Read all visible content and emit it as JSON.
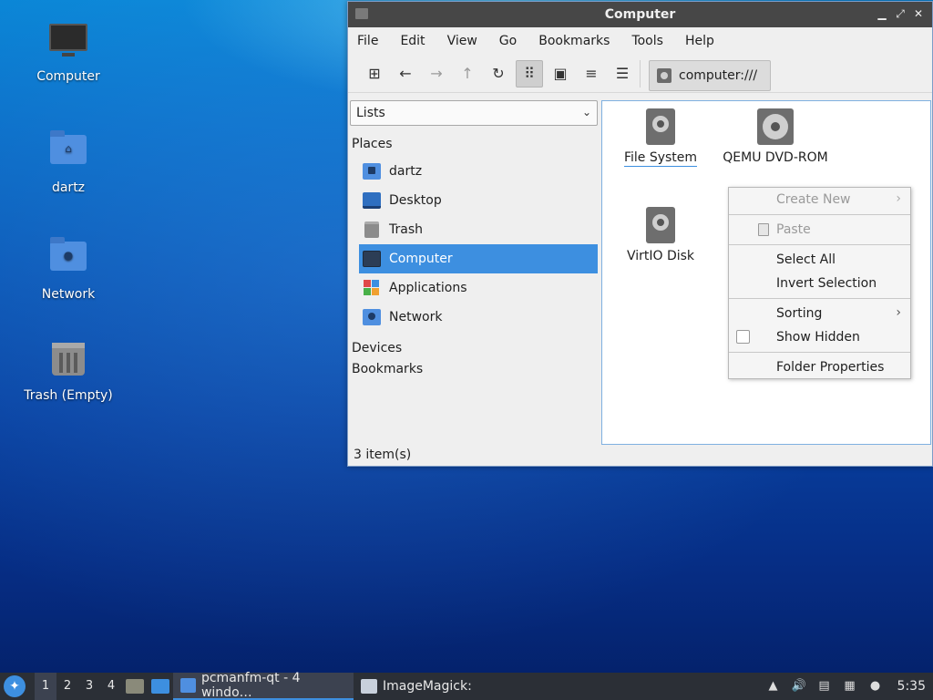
{
  "desktop": {
    "icons": [
      {
        "label": "Computer"
      },
      {
        "label": "dartz"
      },
      {
        "label": "Network"
      },
      {
        "label": "Trash (Empty)"
      }
    ]
  },
  "window": {
    "title": "Computer",
    "controls": {
      "minimize": "▁",
      "maximize": "⤢",
      "close": "✕"
    },
    "menu": [
      "File",
      "Edit",
      "View",
      "Go",
      "Bookmarks",
      "Tools",
      "Help"
    ],
    "address": "computer:///",
    "sidepane": {
      "mode": "Lists",
      "sections": {
        "places": "Places",
        "devices": "Devices",
        "bookmarks": "Bookmarks"
      },
      "places": [
        "dartz",
        "Desktop",
        "Trash",
        "Computer",
        "Applications",
        "Network"
      ],
      "selected": "Computer"
    },
    "items": [
      "File System",
      "QEMU DVD-ROM",
      "VirtIO Disk"
    ],
    "status": "3 item(s)"
  },
  "context_menu": {
    "items": [
      "Create New",
      "Paste",
      "Select All",
      "Invert Selection",
      "Sorting",
      "Show Hidden",
      "Folder Properties"
    ]
  },
  "taskbar": {
    "workspaces": [
      "1",
      "2",
      "3",
      "4"
    ],
    "tasks": [
      "pcmanfm-qt - 4 windo…",
      "ImageMagick:"
    ],
    "clock": "5:35"
  },
  "colors": {
    "accent": "#3d8fe0",
    "titlebar": "#474747",
    "taskbar": "#2b2f36"
  }
}
